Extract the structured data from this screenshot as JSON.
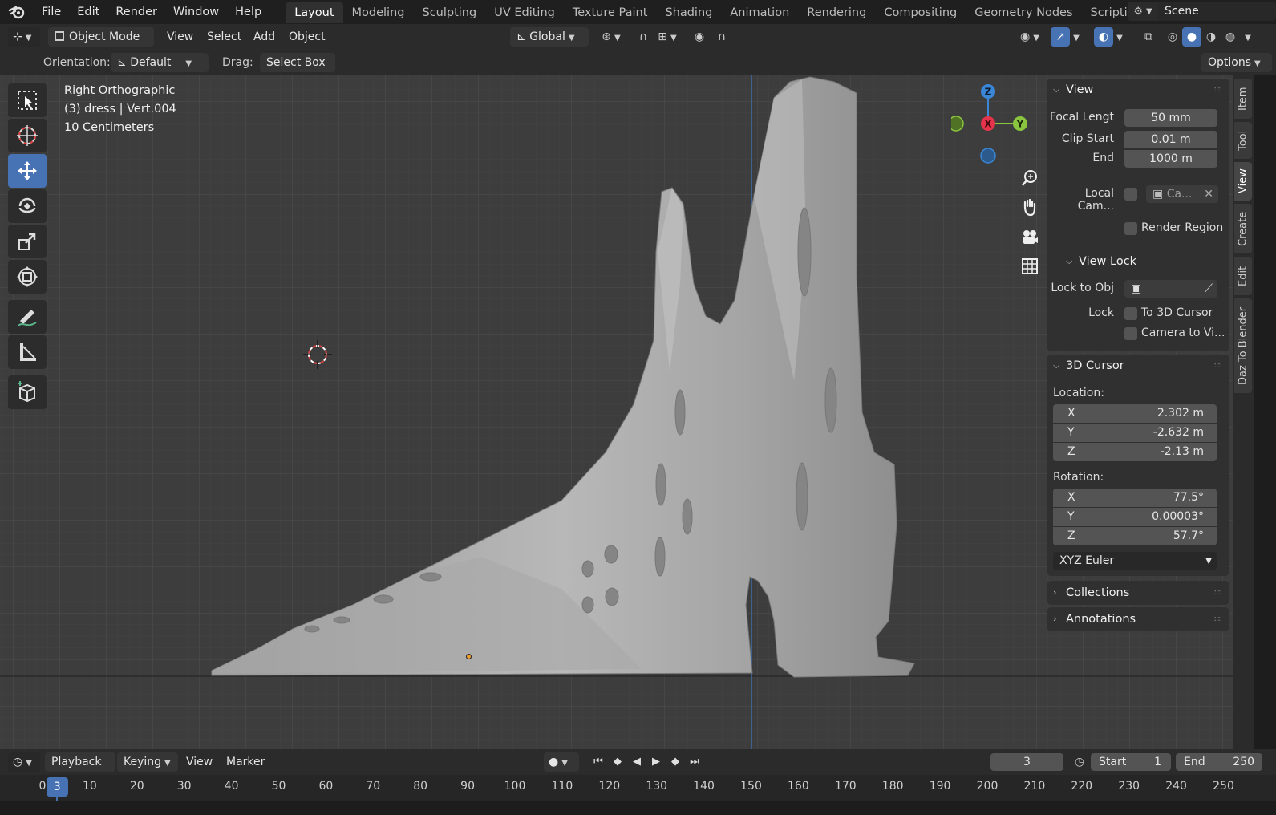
{
  "topbar": {
    "menus": [
      "File",
      "Edit",
      "Render",
      "Window",
      "Help"
    ],
    "workspaces": [
      "Layout",
      "Modeling",
      "Sculpting",
      "UV Editing",
      "Texture Paint",
      "Shading",
      "Animation",
      "Rendering",
      "Compositing",
      "Geometry Nodes",
      "Scripting"
    ],
    "active_workspace": "Layout",
    "add_workspace": "+",
    "scene": "Scene"
  },
  "header": {
    "mode": "Object Mode",
    "menus": [
      "View",
      "Select",
      "Add",
      "Object"
    ],
    "transform_orientation": "Global",
    "options": "Options"
  },
  "toolsettings": {
    "orientation_label": "Orientation:",
    "orientation_value": "Default",
    "drag_label": "Drag:",
    "drag_value": "Select Box"
  },
  "viewport": {
    "view_name": "Right Orthographic",
    "object_info": "(3) dress | Vert.004",
    "scale": "10 Centimeters",
    "gizmo": {
      "z": "Z",
      "x": "X",
      "y": "Y"
    }
  },
  "sidebar": {
    "view_panel": {
      "title": "View",
      "focal_length_label": "Focal Lengt",
      "focal_length": "50 mm",
      "clip_start_label": "Clip Start",
      "clip_start": "0.01 m",
      "clip_end_label": "End",
      "clip_end": "1000 m",
      "local_camera_label": "Local Cam...",
      "local_camera_value": "Ca...",
      "render_region": "Render Region",
      "view_lock_title": "View Lock",
      "lock_to_obj_label": "Lock to Obj",
      "lock_label": "Lock",
      "to_3d_cursor": "To 3D Cursor",
      "camera_to_view": "Camera to Vi..."
    },
    "cursor_panel": {
      "title": "3D Cursor",
      "location_label": "Location:",
      "location": [
        {
          "axis": "X",
          "value": "2.302 m"
        },
        {
          "axis": "Y",
          "value": "-2.632 m"
        },
        {
          "axis": "Z",
          "value": "-2.13 m"
        }
      ],
      "rotation_label": "Rotation:",
      "rotation": [
        {
          "axis": "X",
          "value": "77.5°"
        },
        {
          "axis": "Y",
          "value": "0.00003°"
        },
        {
          "axis": "Z",
          "value": "57.7°"
        }
      ],
      "rotation_mode": "XYZ Euler"
    },
    "collections": "Collections",
    "annotations": "Annotations",
    "tabs": [
      "Item",
      "Tool",
      "View",
      "Create",
      "Edit",
      "Daz To Blender"
    ],
    "active_tab": "View"
  },
  "timeline": {
    "menus": [
      "Playback",
      "Keying",
      "View",
      "Marker"
    ],
    "current_frame": "3",
    "start_label": "Start",
    "start": "1",
    "end_label": "End",
    "end": "250",
    "ruler": [
      "0",
      "10",
      "20",
      "30",
      "40",
      "50",
      "60",
      "70",
      "80",
      "90",
      "100",
      "110",
      "120",
      "130",
      "140",
      "150",
      "160",
      "170",
      "180",
      "190",
      "200",
      "210",
      "220",
      "230",
      "240",
      "250"
    ]
  },
  "colors": {
    "accent": "#4772b3",
    "x_axis": "#e5334b",
    "y_axis": "#8bc53f",
    "z_axis": "#3b86d6"
  }
}
